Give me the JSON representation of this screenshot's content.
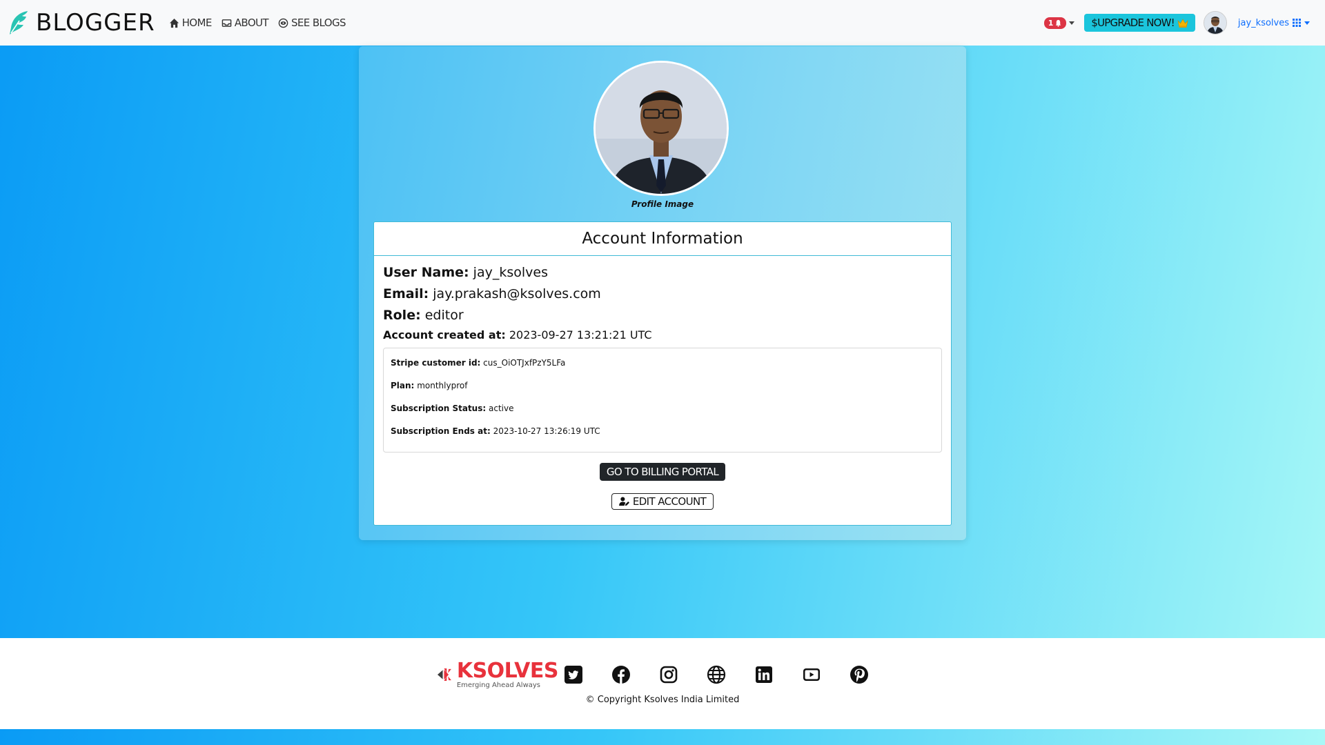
{
  "navbar": {
    "brand": "BLOGGER",
    "links": [
      {
        "label": "HOME",
        "icon": "home-icon"
      },
      {
        "label": "ABOUT",
        "icon": "inbox-icon"
      },
      {
        "label": "SEE BLOGS",
        "icon": "eye-icon"
      }
    ],
    "notification_count": "1",
    "upgrade_label": "$UPGRADE NOW!",
    "username": "jay_ksolves"
  },
  "profile": {
    "image_caption": "Profile Image",
    "card_title": "Account Information",
    "username_label": "User Name:",
    "username_value": "jay_ksolves",
    "email_label": "Email:",
    "email_value": "jay.prakash@ksolves.com",
    "role_label": "Role:",
    "role_value": "editor",
    "created_label": "Account created at:",
    "created_value": "2023-09-27 13:21:21 UTC",
    "stripe": {
      "customer_label": "Stripe customer id:",
      "customer_value": "cus_OiOTJxfPzY5LFa",
      "plan_label": "Plan:",
      "plan_value": "monthlyprof",
      "status_label": "Subscription Status:",
      "status_value": "active",
      "ends_label": "Subscription Ends at:",
      "ends_value": "2023-10-27 13:26:19 UTC"
    },
    "billing_button": "GO TO BILLING PORTAL",
    "edit_button": "EDIT ACCOUNT"
  },
  "footer": {
    "company": "KSOLVES",
    "tagline": "Emerging Ahead Always",
    "copyright": "© Copyright Ksolves India Limited",
    "social_icons": [
      "twitter-icon",
      "facebook-icon",
      "instagram-icon",
      "globe-icon",
      "linkedin-icon",
      "youtube-icon",
      "pinterest-icon"
    ]
  },
  "colors": {
    "accent": "#1bc5dc",
    "brand_red": "#e8323c",
    "logo_teal": "#2ac4b3",
    "link_blue": "#0d6efd",
    "badge_red": "#dc3545"
  }
}
